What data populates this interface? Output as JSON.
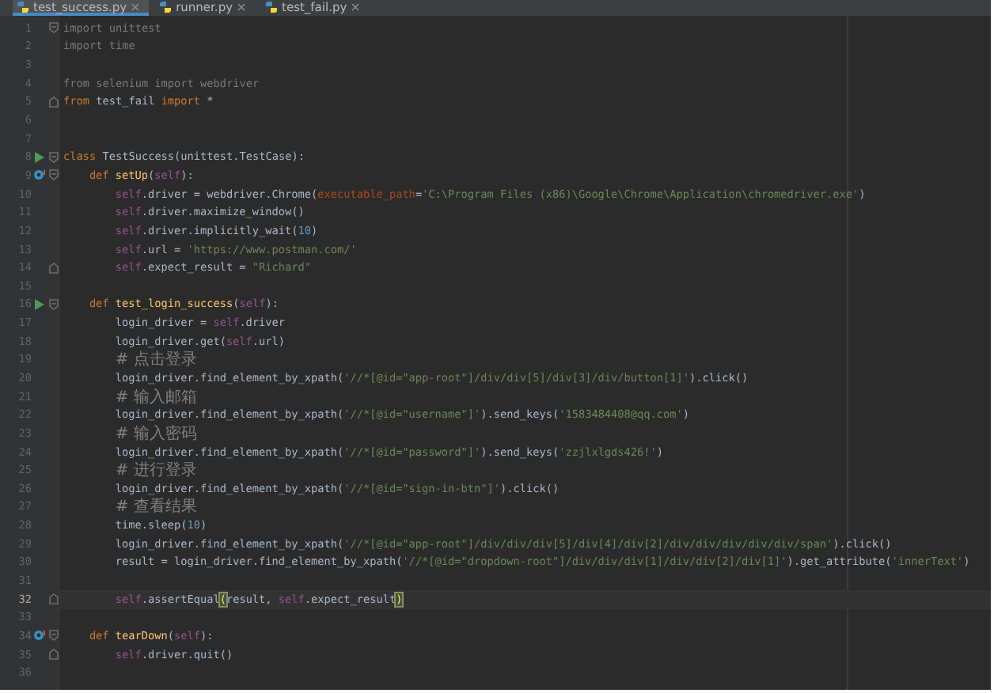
{
  "tabs": [
    {
      "label": "test_success.py",
      "selected": true
    },
    {
      "label": "runner.py",
      "selected": false
    },
    {
      "label": "test_fail.py",
      "selected": false
    }
  ],
  "lines": [
    {
      "number": "1",
      "current": false,
      "markers": [
        {
          "kind": "fold_open"
        }
      ],
      "tokens": [
        {
          "kind": "dim",
          "text": "import unittest"
        }
      ]
    },
    {
      "number": "2",
      "current": false,
      "tokens": [
        {
          "kind": "dim",
          "text": "import time"
        }
      ]
    },
    {
      "number": "3",
      "current": false
    },
    {
      "number": "4",
      "current": false,
      "tokens": [
        {
          "kind": "dim",
          "text": "from selenium import webdriver"
        }
      ]
    },
    {
      "number": "5",
      "current": false,
      "markers": [
        {
          "kind": "fold_close"
        }
      ],
      "tokens": [
        {
          "kind": "kw",
          "text": "from"
        },
        {
          "kind": "plain",
          "text": " test_fail "
        },
        {
          "kind": "kw",
          "text": "import"
        },
        {
          "kind": "plain",
          "text": " *"
        }
      ]
    },
    {
      "number": "6",
      "current": false
    },
    {
      "number": "7",
      "current": false
    },
    {
      "number": "8",
      "current": false,
      "markers": [
        {
          "kind": "run"
        },
        {
          "kind": "fold_open"
        }
      ],
      "tokens": [
        {
          "kind": "kw",
          "text": "class"
        },
        {
          "kind": "plain",
          "text": " TestSuccess(unittest.TestCase):"
        }
      ],
      "children": [
        {
          "number": "9",
          "current": false,
          "markers": [
            {
              "kind": "override"
            },
            {
              "kind": "fold_open"
            }
          ],
          "tokens": [
            {
              "kind": "kw",
              "text": "def "
            },
            {
              "kind": "fn",
              "text": "setUp"
            },
            {
              "kind": "plain",
              "text": "("
            },
            {
              "kind": "self",
              "text": "self"
            },
            {
              "kind": "plain",
              "text": "):"
            }
          ],
          "children": [
            {
              "number": "10",
              "current": false,
              "tokens": [
                {
                  "kind": "self",
                  "text": "self"
                },
                {
                  "kind": "plain",
                  "text": ".driver = webdriver.Chrome("
                },
                {
                  "kind": "param",
                  "text": "executable_path"
                },
                {
                  "kind": "plain",
                  "text": "="
                },
                {
                  "kind": "str",
                  "text": "'C:\\Program Files (x86)\\Google\\Chrome\\Application\\chromedriver.exe'"
                },
                {
                  "kind": "plain",
                  "text": ")"
                }
              ]
            },
            {
              "number": "11",
              "current": false,
              "tokens": [
                {
                  "kind": "self",
                  "text": "self"
                },
                {
                  "kind": "plain",
                  "text": ".driver.maximize_window()"
                }
              ]
            },
            {
              "number": "12",
              "current": false,
              "tokens": [
                {
                  "kind": "self",
                  "text": "self"
                },
                {
                  "kind": "plain",
                  "text": ".driver.implicitly_wait("
                },
                {
                  "kind": "num",
                  "text": "10"
                },
                {
                  "kind": "plain",
                  "text": ")"
                }
              ]
            },
            {
              "number": "13",
              "current": false,
              "tokens": [
                {
                  "kind": "self",
                  "text": "self"
                },
                {
                  "kind": "plain",
                  "text": ".url = "
                },
                {
                  "kind": "str",
                  "text": "'https://www.postman.com/'"
                }
              ]
            },
            {
              "number": "14",
              "current": false,
              "markers": [
                {
                  "kind": "fold_close"
                }
              ],
              "tokens": [
                {
                  "kind": "self",
                  "text": "self"
                },
                {
                  "kind": "plain",
                  "text": ".expect_result = "
                },
                {
                  "kind": "str",
                  "text": "\"Richard\""
                }
              ]
            }
          ]
        },
        {
          "number": "15",
          "current": false
        },
        {
          "number": "16",
          "current": false,
          "markers": [
            {
              "kind": "run"
            },
            {
              "kind": "fold_open"
            }
          ],
          "tokens": [
            {
              "kind": "kw",
              "text": "def "
            },
            {
              "kind": "fn",
              "text": "test_login_success"
            },
            {
              "kind": "plain",
              "text": "("
            },
            {
              "kind": "self",
              "text": "self"
            },
            {
              "kind": "plain",
              "text": "):"
            }
          ],
          "children": [
            {
              "number": "17",
              "current": false,
              "tokens": [
                {
                  "kind": "plain",
                  "text": "login_driver = "
                },
                {
                  "kind": "self",
                  "text": "self"
                },
                {
                  "kind": "plain",
                  "text": ".driver"
                }
              ]
            },
            {
              "number": "18",
              "current": false,
              "tokens": [
                {
                  "kind": "plain",
                  "text": "login_driver.get("
                },
                {
                  "kind": "self",
                  "text": "self"
                },
                {
                  "kind": "plain",
                  "text": ".url)"
                }
              ]
            },
            {
              "number": "19",
              "current": false,
              "tokens": [
                {
                  "kind": "cmt",
                  "text": "# 点击登录"
                }
              ]
            },
            {
              "number": "20",
              "current": false,
              "tokens": [
                {
                  "kind": "plain",
                  "text": "login_driver.find_element_by_xpath("
                },
                {
                  "kind": "str",
                  "text": "'//*[@id=\"app-root\"]/div/div[5]/div[3]/div/button[1]'"
                },
                {
                  "kind": "plain",
                  "text": ").click()"
                }
              ]
            },
            {
              "number": "21",
              "current": false,
              "tokens": [
                {
                  "kind": "cmt",
                  "text": "# 输入邮箱"
                }
              ]
            },
            {
              "number": "22",
              "current": false,
              "tokens": [
                {
                  "kind": "plain",
                  "text": "login_driver.find_element_by_xpath("
                },
                {
                  "kind": "str",
                  "text": "'//*[@id=\"username\"]'"
                },
                {
                  "kind": "plain",
                  "text": ").send_keys("
                },
                {
                  "kind": "str",
                  "text": "'1583484408@qq.com'"
                },
                {
                  "kind": "plain",
                  "text": ")"
                }
              ]
            },
            {
              "number": "23",
              "current": false,
              "tokens": [
                {
                  "kind": "cmt",
                  "text": "# 输入密码"
                }
              ]
            },
            {
              "number": "24",
              "current": false,
              "tokens": [
                {
                  "kind": "plain",
                  "text": "login_driver.find_element_by_xpath("
                },
                {
                  "kind": "str",
                  "text": "'//*[@id=\"password\"]'"
                },
                {
                  "kind": "plain",
                  "text": ").send_keys("
                },
                {
                  "kind": "str",
                  "text": "'zzjlxlgds426!'"
                },
                {
                  "kind": "plain",
                  "text": ")"
                }
              ]
            },
            {
              "number": "25",
              "current": false,
              "tokens": [
                {
                  "kind": "cmt",
                  "text": "# 进行登录"
                }
              ]
            },
            {
              "number": "26",
              "current": false,
              "tokens": [
                {
                  "kind": "plain",
                  "text": "login_driver.find_element_by_xpath("
                },
                {
                  "kind": "str",
                  "text": "'//*[@id=\"sign-in-btn\"]'"
                },
                {
                  "kind": "plain",
                  "text": ").click()"
                }
              ]
            },
            {
              "number": "27",
              "current": false,
              "tokens": [
                {
                  "kind": "cmt",
                  "text": "# 查看结果"
                }
              ]
            },
            {
              "number": "28",
              "current": false,
              "tokens": [
                {
                  "kind": "plain",
                  "text": "time.sleep("
                },
                {
                  "kind": "num",
                  "text": "10"
                },
                {
                  "kind": "plain",
                  "text": ")"
                }
              ]
            },
            {
              "number": "29",
              "current": false,
              "tokens": [
                {
                  "kind": "plain",
                  "text": "login_driver.find_element_by_xpath("
                },
                {
                  "kind": "str",
                  "text": "'//*[@id=\"app-root\"]/div/div/div[5]/div[4]/div[2]/div/div/div/div/div/span'"
                },
                {
                  "kind": "plain",
                  "text": ").click()"
                }
              ]
            },
            {
              "number": "30",
              "current": false,
              "tokens": [
                {
                  "kind": "plain",
                  "text": "result = login_driver.find_element_by_xpath("
                },
                {
                  "kind": "str",
                  "text": "'//*[@id=\"dropdown-root\"]/div/div/div[1]/div/div[2]/div[1]'"
                },
                {
                  "kind": "plain",
                  "text": ").get_attribute("
                },
                {
                  "kind": "str",
                  "text": "'innerText'"
                },
                {
                  "kind": "plain",
                  "text": ")"
                }
              ]
            },
            {
              "number": "31",
              "current": false
            },
            {
              "number": "32",
              "current": true,
              "markers": [
                {
                  "kind": "fold_close"
                }
              ],
              "tokens": [
                {
                  "kind": "self",
                  "text": "self"
                },
                {
                  "kind": "plain",
                  "text": ".assertEqual"
                },
                {
                  "kind": "brace",
                  "text": "("
                },
                {
                  "kind": "plain",
                  "text": "result, "
                },
                {
                  "kind": "self",
                  "text": "self"
                },
                {
                  "kind": "plain",
                  "text": ".expect_result"
                },
                {
                  "kind": "brace",
                  "text": ")"
                }
              ]
            }
          ]
        },
        {
          "number": "33",
          "current": false
        },
        {
          "number": "34",
          "current": false,
          "markers": [
            {
              "kind": "override"
            },
            {
              "kind": "fold_open"
            }
          ],
          "tokens": [
            {
              "kind": "kw",
              "text": "def "
            },
            {
              "kind": "fn",
              "text": "tearDown"
            },
            {
              "kind": "plain",
              "text": "("
            },
            {
              "kind": "self",
              "text": "self"
            },
            {
              "kind": "plain",
              "text": "):"
            }
          ],
          "children": [
            {
              "number": "35",
              "current": false,
              "markers": [
                {
                  "kind": "fold_close"
                }
              ],
              "tokens": [
                {
                  "kind": "self",
                  "text": "self"
                },
                {
                  "kind": "plain",
                  "text": ".driver.quit()"
                }
              ]
            }
          ]
        }
      ]
    },
    {
      "number": "36",
      "current": false
    }
  ]
}
